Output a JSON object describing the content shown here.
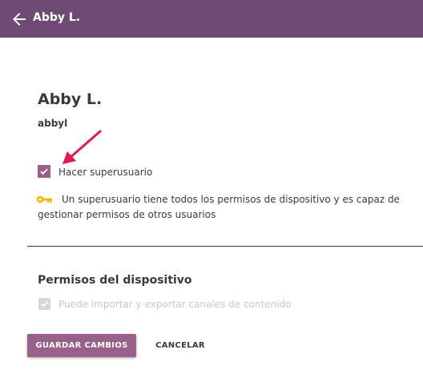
{
  "header": {
    "title": "Abby L.",
    "back_icon": "arrow-left-icon",
    "background": "#6e4a75"
  },
  "user": {
    "full_name": "Abby L.",
    "username": "abbyl"
  },
  "superuser": {
    "checkbox_label": "Hacer superusuario",
    "checked": true,
    "info_icon": "key-icon",
    "info_text": "Un superusuario tiene todos los permisos de dispositivo y es capaz de gestionar permisos de otros usuarios"
  },
  "annotation": {
    "arrow_color": "#e8174c"
  },
  "permissions": {
    "title": "Permisos del dispositivo",
    "items": [
      {
        "label": "Puede importar y exportar canales de contenido",
        "checked": true,
        "disabled": true
      }
    ]
  },
  "actions": {
    "save_label": "GUARDAR CAMBIOS",
    "cancel_label": "CANCELAR"
  },
  "colors": {
    "accent": "#996189",
    "key": "#f5b700"
  }
}
